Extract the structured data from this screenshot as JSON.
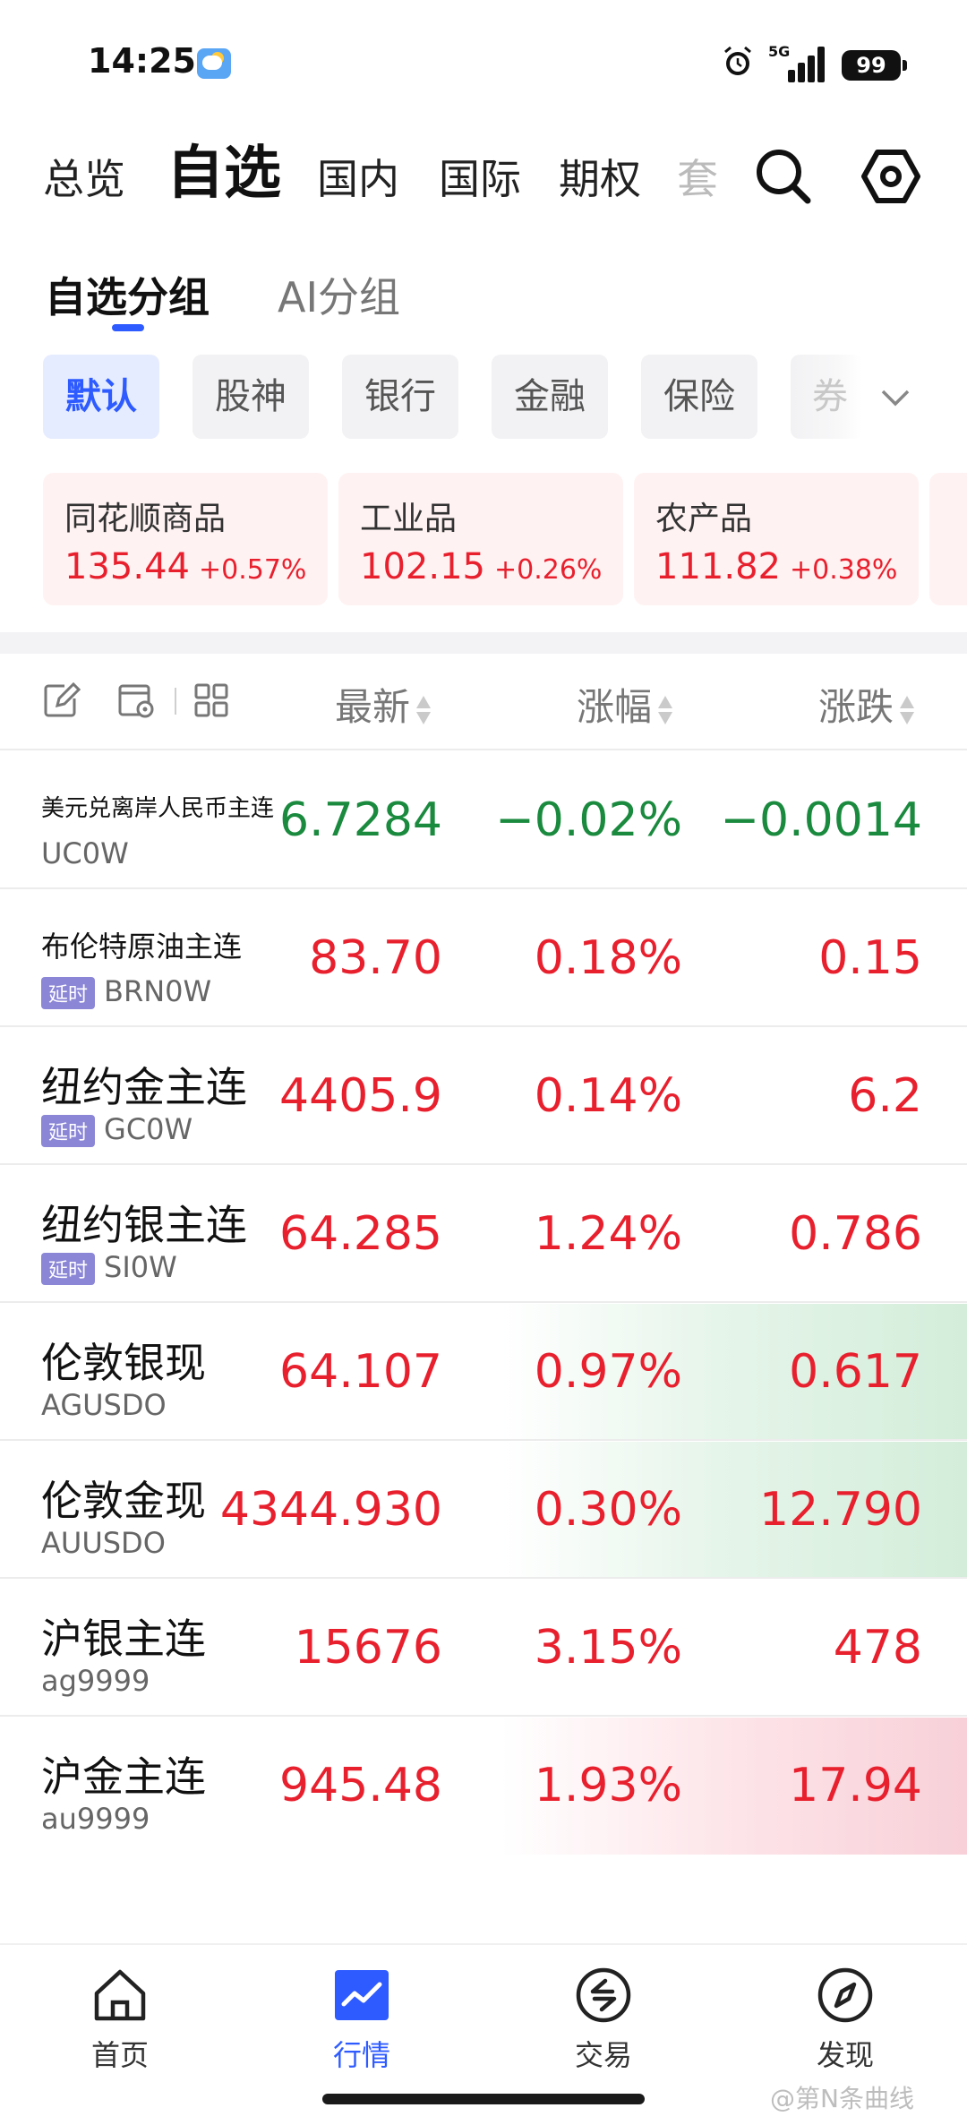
{
  "status_bar": {
    "time": "14:25",
    "network": "5G",
    "battery": "99"
  },
  "top_tabs": [
    "总览",
    "自选",
    "国内",
    "国际",
    "期权",
    "套"
  ],
  "sub_tabs": [
    "自选分组",
    "AI分组"
  ],
  "chips": [
    "默认",
    "股神",
    "银行",
    "金融",
    "保险",
    "券"
  ],
  "cards": [
    {
      "name": "同花顺商品",
      "value": "135.44",
      "change": "+0.57%"
    },
    {
      "name": "工业品",
      "value": "102.15",
      "change": "+0.26%"
    },
    {
      "name": "农产品",
      "value": "111.82",
      "change": "+0.38%"
    }
  ],
  "headers": {
    "latest": "最新",
    "pct": "涨幅",
    "change": "涨跌"
  },
  "delay_label": "延时",
  "rows": [
    {
      "name": "美元兑离岸人民币主连",
      "code": "UC0W",
      "latest": "6.7284",
      "pct": "−0.02%",
      "change": "−0.0014",
      "trend": "down"
    },
    {
      "name": "布伦特原油主连",
      "code": "BRN0W",
      "latest": "83.70",
      "pct": "0.18%",
      "change": "0.15",
      "trend": "up"
    },
    {
      "name": "纽约金主连",
      "code": "GC0W",
      "latest": "4405.9",
      "pct": "0.14%",
      "change": "6.2",
      "trend": "up"
    },
    {
      "name": "纽约银主连",
      "code": "SI0W",
      "latest": "64.285",
      "pct": "1.24%",
      "change": "0.786",
      "trend": "up"
    },
    {
      "name": "伦敦银现",
      "code": "AGUSDO",
      "latest": "64.107",
      "pct": "0.97%",
      "change": "0.617",
      "trend": "up"
    },
    {
      "name": "伦敦金现",
      "code": "AUUSDO",
      "latest": "4344.930",
      "pct": "0.30%",
      "change": "12.790",
      "trend": "up"
    },
    {
      "name": "沪银主连",
      "code": "ag9999",
      "latest": "15676",
      "pct": "3.15%",
      "change": "478",
      "trend": "up"
    },
    {
      "name": "沪金主连",
      "code": "au9999",
      "latest": "945.48",
      "pct": "1.93%",
      "change": "17.94",
      "trend": "up"
    }
  ],
  "bottom_nav": [
    "首页",
    "行情",
    "交易",
    "发现"
  ],
  "watermark": "@第N条曲线",
  "colors": {
    "accent": "#2e5bff",
    "up": "#e8202e",
    "down": "#1a8a3e",
    "delay_tag": "#8b86d6"
  }
}
